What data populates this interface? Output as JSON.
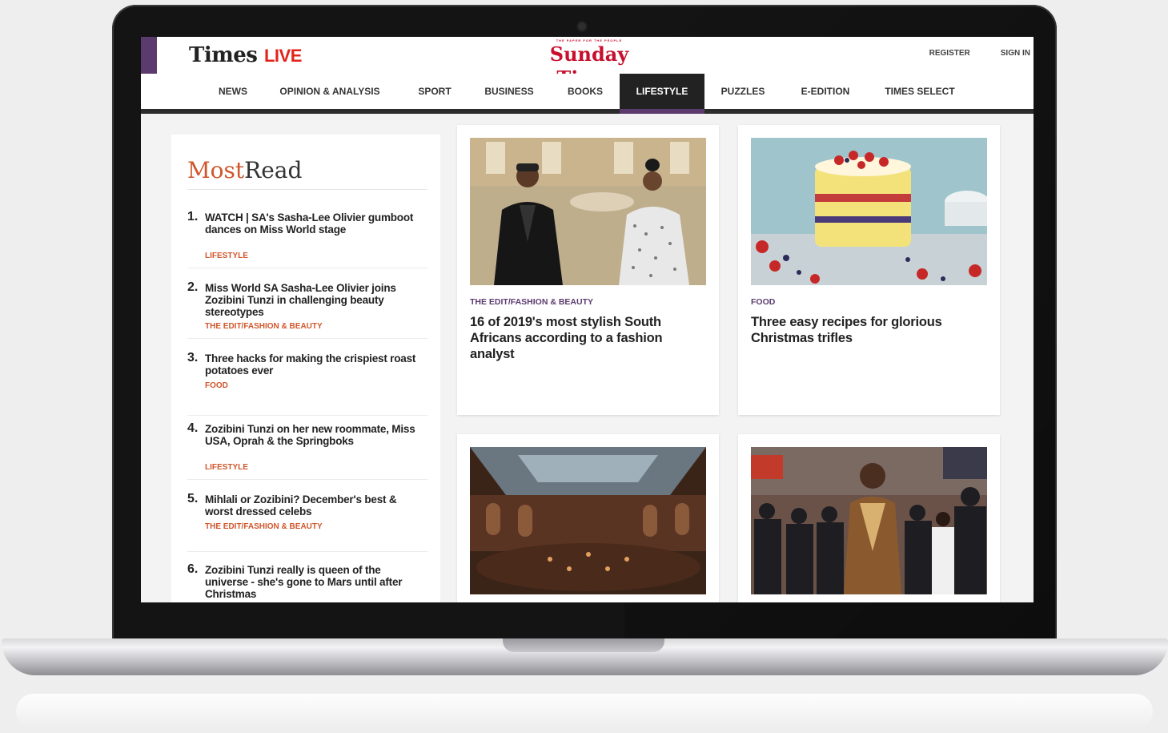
{
  "colors": {
    "brand_purple": "#5b3a6e",
    "section_accent": "#d0562b",
    "sunday_red": "#c8102e",
    "live_red": "#e3231b",
    "nav_active_bg": "#222222"
  },
  "header": {
    "times_logo_main": "Times",
    "times_logo_live": "LIVE",
    "sunday_tagline": "THE PAPER FOR THE PEOPLE",
    "sunday_logo": "Sunday Times",
    "register_label": "REGISTER",
    "signin_label": "SIGN IN"
  },
  "nav": {
    "items": [
      {
        "label": "NEWS"
      },
      {
        "label": "OPINION & ANALYSIS"
      },
      {
        "label": "SPORT"
      },
      {
        "label": "BUSINESS"
      },
      {
        "label": "BOOKS"
      },
      {
        "label": "LIFESTYLE",
        "active": true
      },
      {
        "label": "PUZZLES"
      },
      {
        "label": "E-EDITION"
      },
      {
        "label": "TIMES SELECT"
      }
    ]
  },
  "most_read": {
    "title_first": "Most",
    "title_second": "Read",
    "items": [
      {
        "number": "1.",
        "headline": "WATCH | SA's Sasha-Lee Olivier gumboot dances on Miss World stage",
        "section": "LIFESTYLE"
      },
      {
        "number": "2.",
        "headline": "Miss World SA Sasha-Lee Olivier joins Zozibini Tunzi in challenging beauty stereotypes",
        "section": "THE EDIT/FASHION & BEAUTY"
      },
      {
        "number": "3.",
        "headline": "Three hacks for making the crispiest roast potatoes ever",
        "section": "FOOD"
      },
      {
        "number": "4.",
        "headline": "Zozibini Tunzi on her new roommate, Miss USA, Oprah & the Springboks",
        "section": "LIFESTYLE"
      },
      {
        "number": "5.",
        "headline": "Mihlali or Zozibini? December's best & worst dressed celebs",
        "section": "THE EDIT/FASHION & BEAUTY"
      },
      {
        "number": "6.",
        "headline": "Zozibini Tunzi really is queen of the universe - she's gone to Mars until after Christmas",
        "section": ""
      }
    ]
  },
  "articles": [
    {
      "section": "THE EDIT/FASHION & BEAUTY",
      "headline": "16 of 2019's most stylish South Africans according to a fashion analyst"
    },
    {
      "section": "FOOD",
      "headline": "Three easy recipes for glorious Christmas trifles"
    },
    {
      "section": "",
      "headline": ""
    },
    {
      "section": "",
      "headline": ""
    }
  ]
}
